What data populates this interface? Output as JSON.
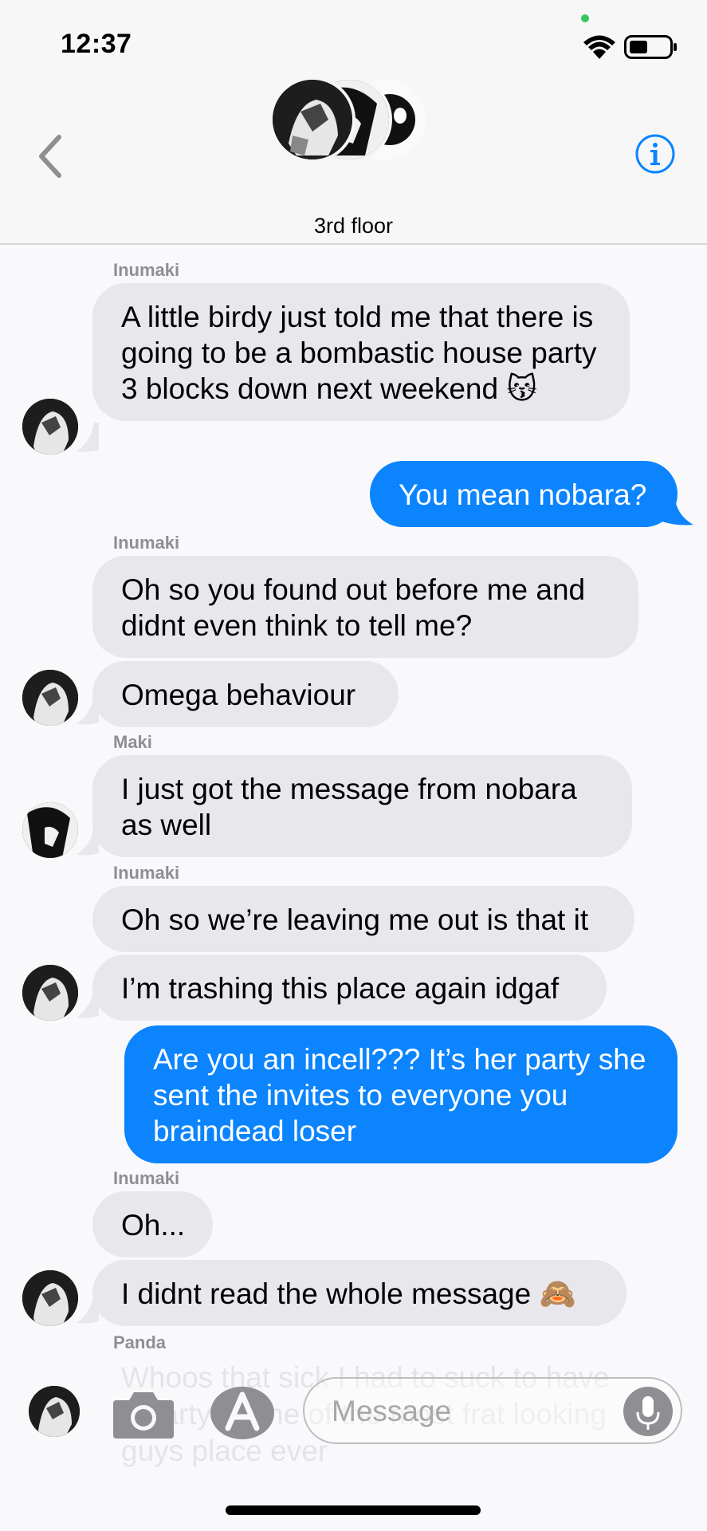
{
  "status": {
    "time": "12:37"
  },
  "header": {
    "title": "3rd floor"
  },
  "messages": [
    {
      "sender": "Inumaki",
      "text": "A little birdy just told me that there is going to be a bombastic house party 3 blocks down next weekend 😽"
    },
    {
      "text": "You mean nobara?"
    },
    {
      "sender": "Inumaki",
      "text": "Oh so you found out before me and didnt even think to tell me?"
    },
    {
      "text": "Omega behaviour"
    },
    {
      "sender": "Maki",
      "text": "I just got the message from nobara as well"
    },
    {
      "sender": "Inumaki",
      "text": "Oh so we’re leaving me out is that it"
    },
    {
      "text": "I’m trashing this place again idgaf"
    },
    {
      "text": "Are you an incell??? It’s her party she sent the invites to everyone you braindead loser"
    },
    {
      "sender": "Inumaki",
      "text": "Oh..."
    },
    {
      "text": "I didnt read the whole message 🙈"
    },
    {
      "sender": "Panda",
      "text": "Whoos that sick I had to suck to have a party in one of the most frat looking guys place ever"
    }
  ],
  "composer": {
    "placeholder": "Message"
  },
  "colors": {
    "outgoing": "#0b84fe",
    "incoming": "#e8e7ec",
    "accent": "#0b84fe"
  }
}
